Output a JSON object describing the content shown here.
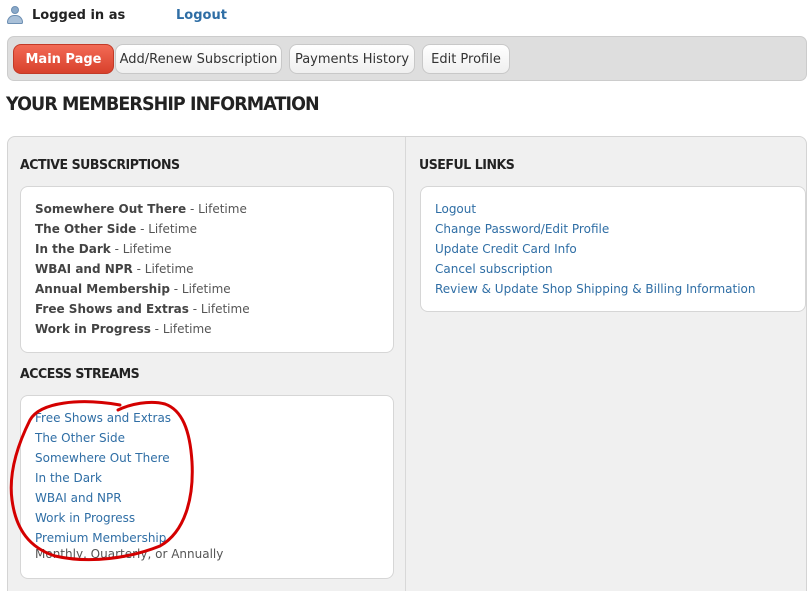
{
  "header": {
    "logged_in_label": "Logged in as",
    "logout_label": "Logout"
  },
  "nav": {
    "tabs": [
      {
        "label": "Main Page",
        "active": true
      },
      {
        "label": "Add/Renew Subscription",
        "active": false
      },
      {
        "label": "Payments History",
        "active": false
      },
      {
        "label": "Edit Profile",
        "active": false
      }
    ]
  },
  "page_title": "YOUR MEMBERSHIP INFORMATION",
  "active_subscriptions": {
    "heading": "ACTIVE SUBSCRIPTIONS",
    "items": [
      {
        "name": "Somewhere Out There",
        "term": " - Lifetime"
      },
      {
        "name": "The Other Side",
        "term": " - Lifetime"
      },
      {
        "name": "In the Dark",
        "term": " - Lifetime"
      },
      {
        "name": "WBAI and NPR",
        "term": " - Lifetime"
      },
      {
        "name": "Annual Membership",
        "term": " - Lifetime"
      },
      {
        "name": "Free Shows and Extras",
        "term": " - Lifetime"
      },
      {
        "name": "Work in Progress",
        "term": " - Lifetime"
      }
    ]
  },
  "access_streams": {
    "heading": "ACCESS STREAMS",
    "items": [
      "Free Shows and Extras",
      "The Other Side",
      "Somewhere Out There",
      "In the Dark",
      "WBAI and NPR",
      "Work in Progress",
      "Premium Membership"
    ],
    "note": "Monthly, Quarterly, or Annually"
  },
  "useful_links": {
    "heading": "USEFUL LINKS",
    "items": [
      "Logout",
      "Change Password/Edit Profile",
      "Update Credit Card Info",
      "Cancel subscription",
      "Review & Update Shop Shipping & Billing Information"
    ]
  },
  "colors": {
    "link": "#2f6ea5",
    "active_tab": "#e0513b",
    "annotation": "#d40000"
  }
}
